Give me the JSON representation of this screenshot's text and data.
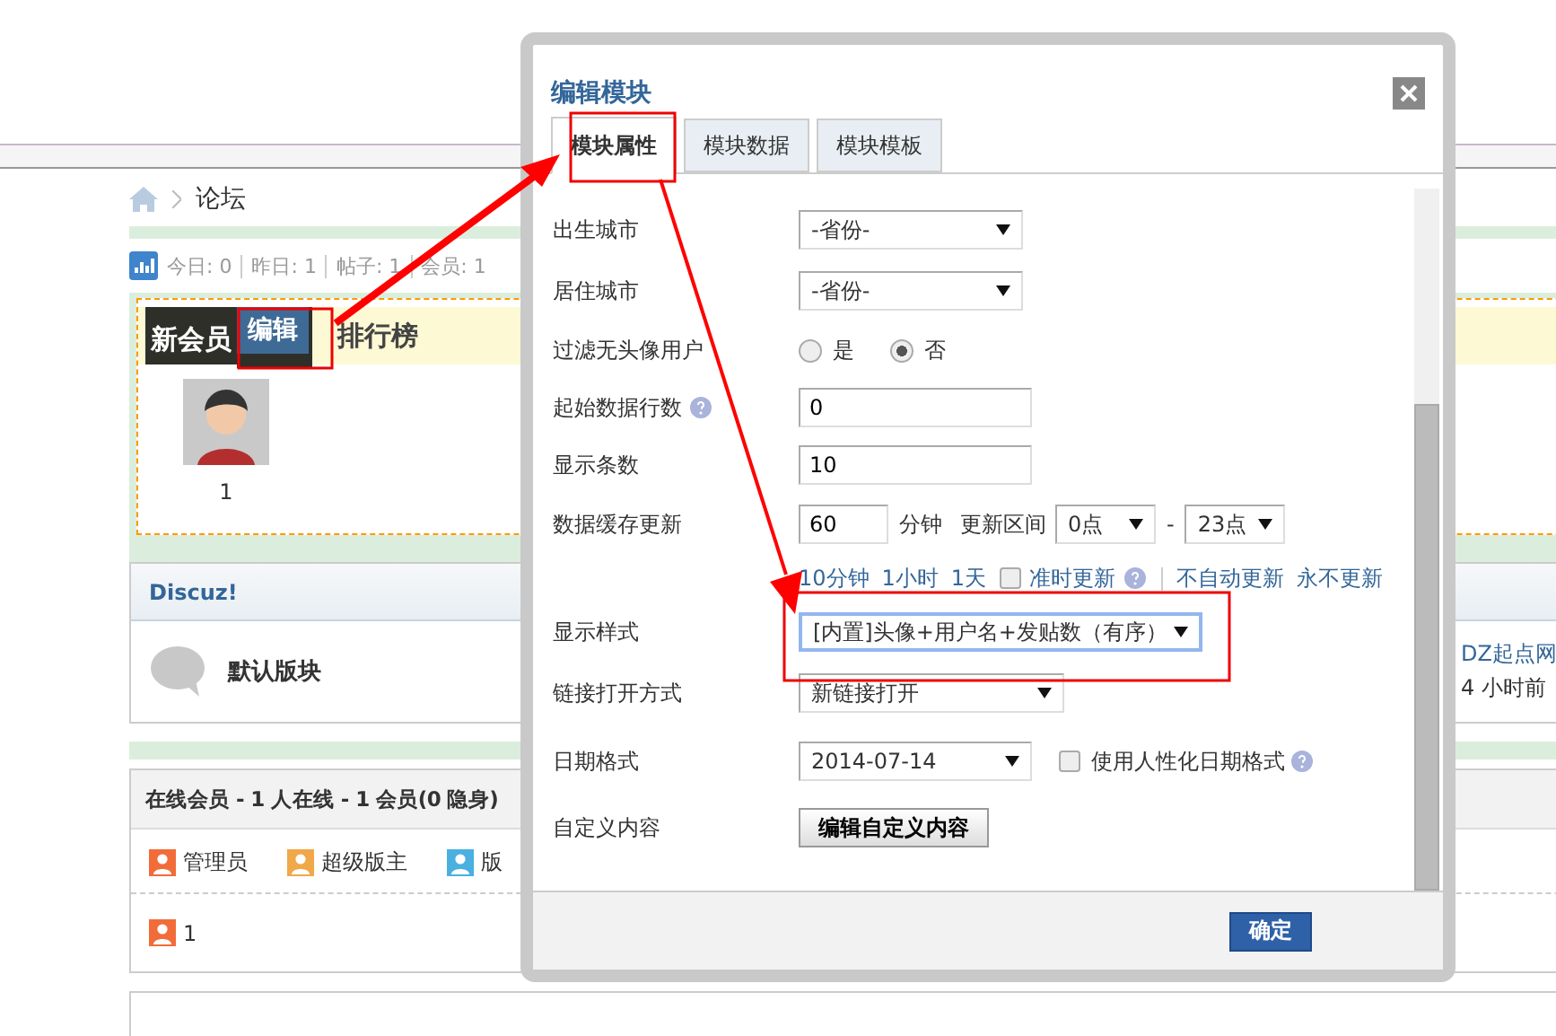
{
  "page": {
    "breadcrumb": "论坛",
    "stats": [
      {
        "label": "今日:",
        "value": "0"
      },
      {
        "label": "昨日:",
        "value": "1"
      },
      {
        "label": "帖子:",
        "value": "1"
      },
      {
        "label": "会员:",
        "value": "1"
      }
    ],
    "new_members": {
      "tabs": [
        {
          "label": "新会员",
          "selected": true
        },
        {
          "label": "排行榜",
          "selected": false
        }
      ],
      "edit_button": "编辑",
      "members": [
        {
          "name": "1"
        }
      ]
    },
    "category": {
      "title": "Discuz!",
      "forums": [
        {
          "name": "默认版块",
          "last_post_link": "DZ起点网",
          "last_post_time": "4 小时前"
        }
      ]
    },
    "online": {
      "title": "在线会员 - 1 人在线 - 1 会员(0 隐身)",
      "legend": [
        {
          "label": "管理员",
          "color": "#f26c3a"
        },
        {
          "label": "超级版主",
          "color": "#f0a848"
        },
        {
          "label": "版",
          "color": "#4ab0e0"
        }
      ],
      "users": [
        {
          "name": "1",
          "color": "#f26c3a"
        }
      ]
    }
  },
  "dialog": {
    "title": "编辑模块",
    "tabs": [
      {
        "label": "模块属性",
        "selected": true
      },
      {
        "label": "模块数据",
        "selected": false
      },
      {
        "label": "模块模板",
        "selected": false
      }
    ],
    "rows": [
      {
        "kind": "select",
        "label": "出生城市",
        "value": "-省份-"
      },
      {
        "kind": "select",
        "label": "居住城市",
        "value": "-省份-"
      },
      {
        "kind": "radio",
        "label": "过滤无头像用户",
        "options": [
          {
            "label": "是",
            "selected": false
          },
          {
            "label": "否",
            "selected": true
          }
        ]
      },
      {
        "kind": "input",
        "label": "起始数据行数",
        "help": true,
        "value": "0"
      },
      {
        "kind": "input",
        "label": "显示条数",
        "value": "10"
      },
      {
        "kind": "cache",
        "label": "数据缓存更新",
        "value": "60",
        "unit": "分钟",
        "range_label": "更新区间",
        "from": "0点",
        "separator": "-",
        "to": "23点"
      },
      {
        "kind": "links",
        "links": [
          "10分钟",
          "1小时",
          "1天"
        ],
        "checkbox": {
          "label": "准时更新",
          "checked": false
        },
        "help": true,
        "extra_links": [
          "不自动更新",
          "永不更新"
        ]
      },
      {
        "kind": "select",
        "label": "显示样式",
        "value": "[内置]头像+用户名+发贴数（有序）",
        "focused": true
      },
      {
        "kind": "select",
        "label": "链接打开方式",
        "value": "新链接打开"
      },
      {
        "kind": "date",
        "label": "日期格式",
        "value": "2014-07-14",
        "checkbox": {
          "label": "使用人性化日期格式",
          "checked": false
        },
        "help": true
      },
      {
        "kind": "button",
        "label": "自定义内容",
        "button": "编辑自定义内容"
      }
    ],
    "buttons": [
      "确定"
    ]
  }
}
